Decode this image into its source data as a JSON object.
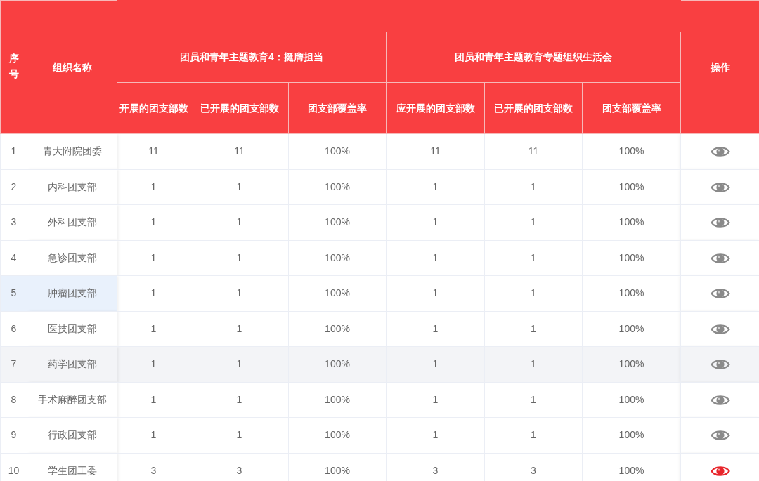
{
  "header": {
    "index": "序号",
    "name": "组织名称",
    "action": "操作",
    "groups": [
      {
        "title": "团员和青年主题教育4：挺膺担当",
        "columns": [
          "开展的团支部数",
          "已开展的团支部数",
          "团支部覆盖率"
        ]
      },
      {
        "title": "团员和青年主题教育专题组织生活会",
        "columns": [
          "应开展的团支部数",
          "已开展的团支部数",
          "团支部覆盖率"
        ]
      }
    ]
  },
  "rows": [
    {
      "index": "1",
      "name": "青大附院团委",
      "values": [
        "11",
        "11",
        "100%",
        "11",
        "11",
        "100%"
      ],
      "hovered": false,
      "name_highlighted": false,
      "action_active": false
    },
    {
      "index": "2",
      "name": "内科团支部",
      "values": [
        "1",
        "1",
        "100%",
        "1",
        "1",
        "100%"
      ],
      "hovered": false,
      "name_highlighted": false,
      "action_active": false
    },
    {
      "index": "3",
      "name": "外科团支部",
      "values": [
        "1",
        "1",
        "100%",
        "1",
        "1",
        "100%"
      ],
      "hovered": false,
      "name_highlighted": false,
      "action_active": false
    },
    {
      "index": "4",
      "name": "急诊团支部",
      "values": [
        "1",
        "1",
        "100%",
        "1",
        "1",
        "100%"
      ],
      "hovered": false,
      "name_highlighted": false,
      "action_active": false
    },
    {
      "index": "5",
      "name": "肿瘤团支部",
      "values": [
        "1",
        "1",
        "100%",
        "1",
        "1",
        "100%"
      ],
      "hovered": false,
      "name_highlighted": true,
      "action_active": false
    },
    {
      "index": "6",
      "name": "医技团支部",
      "values": [
        "1",
        "1",
        "100%",
        "1",
        "1",
        "100%"
      ],
      "hovered": false,
      "name_highlighted": false,
      "action_active": false
    },
    {
      "index": "7",
      "name": "药学团支部",
      "values": [
        "1",
        "1",
        "100%",
        "1",
        "1",
        "100%"
      ],
      "hovered": true,
      "name_highlighted": false,
      "action_active": false
    },
    {
      "index": "8",
      "name": "手术麻醉团支部",
      "values": [
        "1",
        "1",
        "100%",
        "1",
        "1",
        "100%"
      ],
      "hovered": false,
      "name_highlighted": false,
      "action_active": false
    },
    {
      "index": "9",
      "name": "行政团支部",
      "values": [
        "1",
        "1",
        "100%",
        "1",
        "1",
        "100%"
      ],
      "hovered": false,
      "name_highlighted": false,
      "action_active": false
    },
    {
      "index": "10",
      "name": "学生团工委",
      "values": [
        "3",
        "3",
        "100%",
        "3",
        "3",
        "100%"
      ],
      "hovered": false,
      "name_highlighted": false,
      "action_active": true
    }
  ]
}
